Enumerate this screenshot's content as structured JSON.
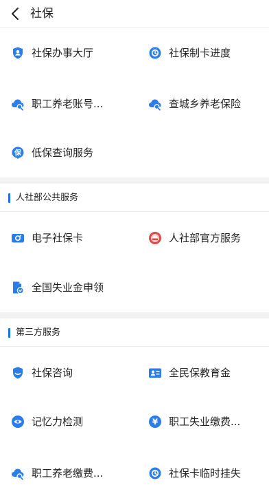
{
  "header": {
    "back_icon": "chevron-left-icon",
    "title": "社保"
  },
  "colors": {
    "accent": "#1a73e8",
    "icon_blue": "#2b7de9",
    "icon_red": "#d94c4c",
    "band": "#f2f2f2"
  },
  "sections": [
    {
      "title": "",
      "items": [
        {
          "label": "社保办事大厅",
          "icon": "shield-person-icon"
        },
        {
          "label": "社保制卡进度",
          "icon": "card-progress-icon"
        },
        {
          "label": "职工养老账号...",
          "icon": "cloud-search-icon"
        },
        {
          "label": "查城乡养老保险",
          "icon": "cloud-search-icon"
        },
        {
          "label": "低保查询服务",
          "icon": "bao-badge-icon"
        }
      ]
    },
    {
      "title": "人社部公共服务",
      "items": [
        {
          "label": "电子社保卡",
          "icon": "id-card-icon"
        },
        {
          "label": "人社部官方服务",
          "icon": "ministry-emblem-icon"
        },
        {
          "label": "全国失业金申领",
          "icon": "document-shield-icon"
        }
      ]
    },
    {
      "title": "第三方服务",
      "items": [
        {
          "label": "社保咨询",
          "icon": "shield-icon"
        },
        {
          "label": "全民保教育金",
          "icon": "person-card-icon"
        },
        {
          "label": "记忆力检测",
          "icon": "brain-circle-icon"
        },
        {
          "label": "职工失业缴费...",
          "icon": "yen-circle-icon"
        },
        {
          "label": "职工养老缴费...",
          "icon": "cloud-search-icon"
        },
        {
          "label": "社保卡临时挂失",
          "icon": "card-lock-icon"
        }
      ]
    }
  ]
}
